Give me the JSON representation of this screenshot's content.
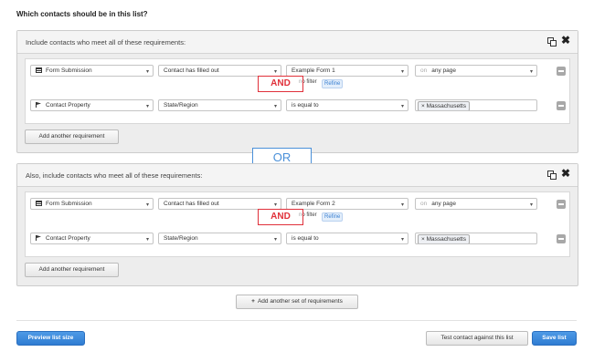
{
  "heading": "Which contacts should be in this list?",
  "groups": [
    {
      "title": "Include contacts who meet all of these requirements:",
      "row1": {
        "type": "Form Submission",
        "condition": "Contact has filled out",
        "value": "Example Form 1",
        "on_label": "on",
        "page": "any page",
        "subtext": "no filter",
        "refine": "Refine"
      },
      "and_label": "AND",
      "row2": {
        "type": "Contact Property",
        "property": "State/Region",
        "operator": "is equal to",
        "tag_x": "×",
        "tag": "Massachusetts"
      },
      "add_requirement": "Add another requirement"
    },
    {
      "title": "Also, include contacts who meet all of these requirements:",
      "row1": {
        "type": "Form Submission",
        "condition": "Contact has filled out",
        "value": "Example Form 2",
        "on_label": "on",
        "page": "any page",
        "subtext": "no filter",
        "refine": "Refine"
      },
      "and_label": "AND",
      "row2": {
        "type": "Contact Property",
        "property": "State/Region",
        "operator": "is equal to",
        "tag_x": "×",
        "tag": "Massachusetts"
      },
      "add_requirement": "Add another requirement"
    }
  ],
  "or_label": "OR",
  "add_set": "Add another set of requirements",
  "add_set_icon": "+",
  "footer": {
    "preview": "Preview list size",
    "test": "Test contact against this list",
    "save": "Save list"
  },
  "icons": {
    "caret": "▾",
    "close": "✖"
  },
  "colors": {
    "and_outline": "#e0303a",
    "or_outline": "#4a90d9",
    "primary_button": "#3a86d8"
  }
}
